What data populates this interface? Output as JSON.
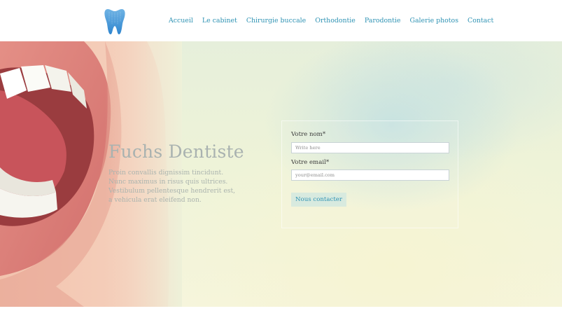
{
  "header": {
    "logo_icon": "tooth-icon",
    "nav": [
      {
        "label": "Accueil"
      },
      {
        "label": "Le cabinet"
      },
      {
        "label": "Chirurgie buccale"
      },
      {
        "label": "Orthodontie"
      },
      {
        "label": "Parodontie"
      },
      {
        "label": "Galerie photos"
      },
      {
        "label": "Contact"
      }
    ]
  },
  "hero": {
    "title": "Fuchs Dentiste",
    "text": "Proin convallis dignissim tincidunt. Nunc maximus in risus quis ultrices. Vestibulum pellentesque hendrerit est, a vehicula erat eleifend non.",
    "image": "smiling-mouth-photo"
  },
  "form": {
    "name_label": "Votre nom*",
    "name_placeholder": "Write here",
    "email_label": "Votre email*",
    "email_placeholder": "your@email.com",
    "submit_label": "Nous contacter"
  },
  "colors": {
    "accent": "#2f93b4",
    "button_bg": "#d8eadf",
    "hero_text": "#aab3ae"
  }
}
